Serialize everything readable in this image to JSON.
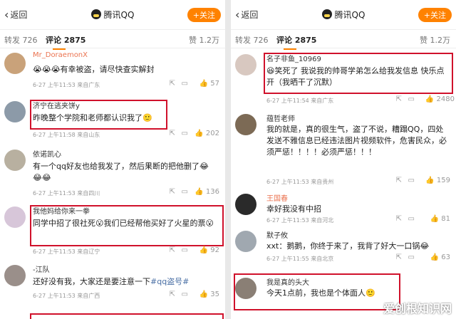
{
  "left": {
    "header": {
      "back": "返回",
      "title": "腾讯QQ",
      "follow": "+关注"
    },
    "tabs": {
      "forward": "转发 726",
      "comments": "评论 2875",
      "likes": "赞 1.2万"
    },
    "comments": [
      {
        "name": "Mr_DoraemonX",
        "text": "😭😭😭有幸被盗，请尽快查实解封",
        "meta": "6-27 上午11:53 来自广东",
        "likes": "57"
      },
      {
        "name": "济宁在逃夹饼y",
        "text": "昨晚整个学院和老师都认识我了🙂",
        "meta": "6-27 上午11:58 来自山东",
        "likes": "202"
      },
      {
        "name": "依诺凯心",
        "text": "有一个qq好友也给我发了，然后果断的把他删了😂😂😂",
        "meta": "6-27 上午11:53 来自四川",
        "likes": "136"
      },
      {
        "name": "我他妈给你来一拳",
        "text": "同学中招了很社死😮我们已经帮他买好了火星的票😮",
        "meta": "6-27 上午11:53 来自辽宁",
        "likes": "92"
      },
      {
        "name": "-江队",
        "text_before": "还好没有我，大家还是要注意一下",
        "hashtag": "#qq盗号#",
        "meta": "6-27 上午11:53 来自广西",
        "likes": "35"
      }
    ]
  },
  "right": {
    "header": {
      "back": "返回",
      "title": "腾讯QQ",
      "follow": "+关注"
    },
    "tabs": {
      "forward": "转发 726",
      "comments": "评论 2875",
      "likes": "赞 1.2万"
    },
    "comments": [
      {
        "name": "名子非鱼_10969",
        "text": "😆笑死了 我说我的帅哥学弟怎么给我发信息 快乐点开（我晒干了沉默）",
        "meta": "6-27 上午11:54 来自广东",
        "likes": "2480"
      },
      {
        "name": "蕴哲老师",
        "text": "我的就是，真的很生气，盗了不说，糟蹋QQ，四处发送不雅信息已经违法图片视频软件，危害民众，必须严惩！！！！必须严惩！！！",
        "meta": "6-27 上午11:53 来自贵州",
        "likes": "159"
      },
      {
        "name": "王国春",
        "text": "幸好我没有中招",
        "meta": "6-27 上午11:53 来自河北",
        "likes": "81"
      },
      {
        "name": "默子攸",
        "text": "xxt：鹅鹅，你终于来了，我背了好大一口锅😂",
        "meta": "6-27 上午11:55 来自北京",
        "likes": "63"
      },
      {
        "name": "我是真的头大",
        "text": "今天1点前，我也是个体面人🙂",
        "meta": "",
        "likes": ""
      }
    ],
    "watermark": "爱创根知识网"
  },
  "colors": {
    "accent": "#ff8200",
    "highlight_box": "#d0112b",
    "name_blue": "#4a6fa5"
  }
}
